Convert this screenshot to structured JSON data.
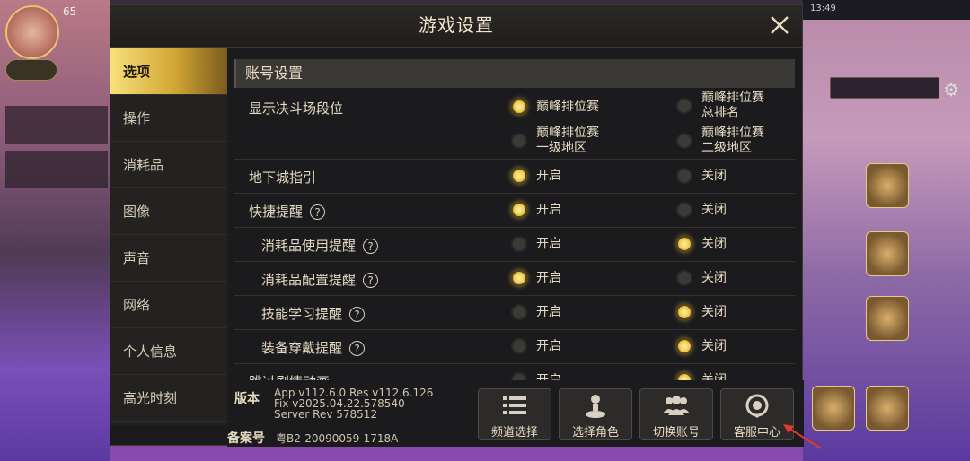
{
  "dialog": {
    "title": "游戏设置"
  },
  "sidebar": {
    "items": [
      {
        "label": "选项",
        "active": true
      },
      {
        "label": "操作"
      },
      {
        "label": "消耗品"
      },
      {
        "label": "图像"
      },
      {
        "label": "声音"
      },
      {
        "label": "网络"
      },
      {
        "label": "个人信息"
      },
      {
        "label": "高光时刻"
      }
    ]
  },
  "section": {
    "title": "账号设置"
  },
  "rows": {
    "arena": {
      "label": "显示决斗场段位",
      "options": [
        {
          "label": "巅峰排位赛",
          "selected": true
        },
        {
          "line1": "巅峰排位赛",
          "line2": "总排名",
          "selected": false
        },
        {
          "line1": "巅峰排位赛",
          "line2": "一级地区",
          "selected": false
        },
        {
          "line1": "巅峰排位赛",
          "line2": "二级地区",
          "selected": false
        }
      ]
    },
    "dungeon_guide": {
      "label": "地下城指引",
      "on": "开启",
      "off": "关闭",
      "selected": "on"
    },
    "quick_tip": {
      "label": "快捷提醒",
      "help": "?",
      "on": "开启",
      "off": "关闭",
      "selected": "on"
    },
    "consume_use": {
      "label": "消耗品使用提醒",
      "help": "?",
      "on": "开启",
      "off": "关闭",
      "selected": "off"
    },
    "consume_config": {
      "label": "消耗品配置提醒",
      "help": "?",
      "on": "开启",
      "off": "关闭",
      "selected": "on"
    },
    "skill_learn": {
      "label": "技能学习提醒",
      "help": "?",
      "on": "开启",
      "off": "关闭",
      "selected": "off"
    },
    "equip_wear": {
      "label": "装备穿戴提醒",
      "help": "?",
      "on": "开启",
      "off": "关闭",
      "selected": "off"
    },
    "skip_story": {
      "label": "跳过剧情动画",
      "on": "开启",
      "off": "关闭",
      "selected": "off"
    }
  },
  "footer": {
    "version_label": "版本",
    "version_line1": "App v112.6.0 Res v112.6.126",
    "version_line2": "Fix v2025.04.22.578540",
    "version_line3": "Server Rev 578512",
    "icp_label": "备案号",
    "icp_value": "粤B2-20090059-1718A",
    "buttons": [
      {
        "label": "频道选择",
        "icon": "list-icon"
      },
      {
        "label": "选择角色",
        "icon": "character-pawn-icon"
      },
      {
        "label": "切换账号",
        "icon": "users-icon"
      },
      {
        "label": "客服中心",
        "icon": "support-headset-icon"
      }
    ]
  },
  "background": {
    "level": "65",
    "time": "13:49"
  },
  "colors": {
    "accent": "#f1cc52",
    "panel": "#1b1b1d",
    "active_tab": "#d3a634"
  }
}
